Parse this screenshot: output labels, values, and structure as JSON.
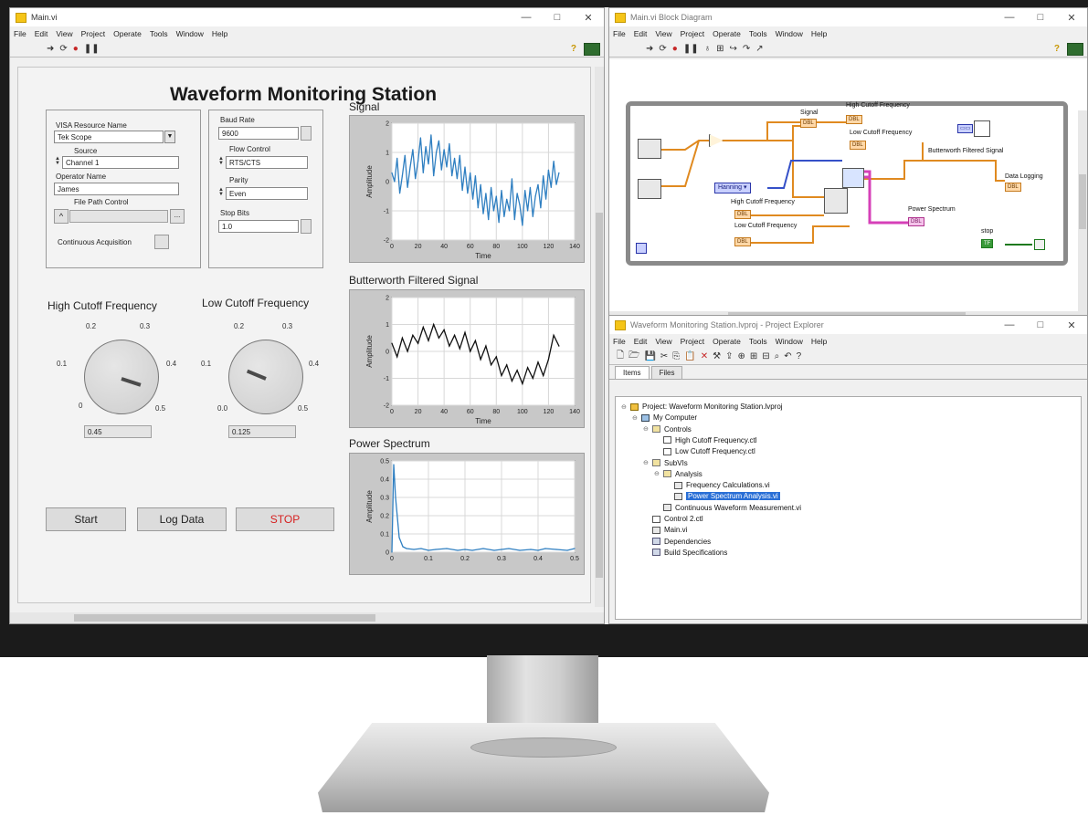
{
  "front_panel": {
    "window_title": "Main.vi",
    "menu": [
      "File",
      "Edit",
      "View",
      "Project",
      "Operate",
      "Tools",
      "Window",
      "Help"
    ],
    "controls": {
      "minimize": "—",
      "maximize": "□",
      "close": "✕"
    },
    "heading": "Waveform Monitoring Station",
    "visa_resource_label": "VISA Resource Name",
    "visa_resource_value": "Tek Scope",
    "source_label": "Source",
    "source_value": "Channel 1",
    "operator_label": "Operator Name",
    "operator_value": "James",
    "file_path_label": "File Path Control",
    "continuous_label": "Continuous Acquisition",
    "baud_label": "Baud Rate",
    "baud_value": "9600",
    "flow_label": "Flow Control",
    "flow_value": "RTS/CTS",
    "parity_label": "Parity",
    "parity_value": "Even",
    "stop_bits_label": "Stop Bits",
    "stop_bits_value": "1.0",
    "high_knob_title": "High Cutoff Frequency",
    "low_knob_title": "Low Cutoff Frequency",
    "high_knob_value": 0.45,
    "low_knob_value": 0.125,
    "high_knob_display": "0.45",
    "low_knob_display": "0.125",
    "high_ticks": [
      "0.1",
      "0.2",
      "0.3",
      "0.4",
      "0",
      "0.5"
    ],
    "low_ticks": [
      "0.1",
      "0.2",
      "0.3",
      "0.4",
      "0.0",
      "0.5"
    ],
    "start_label": "Start",
    "log_label": "Log Data",
    "stop_label": "STOP"
  },
  "chart_data": [
    {
      "type": "line",
      "title": "Signal",
      "xlabel": "Time",
      "ylabel": "Amplitude",
      "xlim": [
        0,
        140
      ],
      "ylim": [
        -2,
        2
      ],
      "xticks": [
        0,
        20,
        40,
        60,
        80,
        100,
        120,
        140
      ],
      "yticks": [
        -2,
        -1,
        0,
        1,
        2
      ],
      "series": [
        {
          "color": "#2f7fc1",
          "x": [
            0,
            2,
            4,
            6,
            8,
            10,
            12,
            14,
            16,
            18,
            20,
            22,
            24,
            26,
            28,
            30,
            32,
            34,
            36,
            38,
            40,
            42,
            44,
            46,
            48,
            50,
            52,
            54,
            56,
            58,
            60,
            62,
            64,
            66,
            68,
            70,
            72,
            74,
            76,
            78,
            80,
            82,
            84,
            86,
            88,
            90,
            92,
            94,
            96,
            98,
            100,
            102,
            104,
            106,
            108,
            110,
            112,
            114,
            116,
            118,
            120,
            122,
            124,
            126,
            128
          ],
          "values": [
            0.3,
            0.0,
            0.8,
            -0.4,
            0.2,
            0.9,
            -0.2,
            0.5,
            1.1,
            0.1,
            0.7,
            1.5,
            0.3,
            1.2,
            0.6,
            1.6,
            0.2,
            1.0,
            1.4,
            0.4,
            1.1,
            0.5,
            1.3,
            0.2,
            0.8,
            0.1,
            0.9,
            -0.3,
            0.5,
            -0.4,
            0.3,
            -0.6,
            0.2,
            -0.9,
            -0.1,
            -1.1,
            -0.4,
            -1.3,
            -0.2,
            -1.0,
            -0.5,
            -1.4,
            -0.3,
            -1.2,
            -0.6,
            -1.0,
            0.1,
            -1.3,
            -0.4,
            -0.8,
            -1.5,
            -0.3,
            -1.0,
            -0.2,
            -1.2,
            -0.5,
            -0.1,
            -0.9,
            0.2,
            -0.6,
            0.4,
            -0.2,
            0.7,
            -0.1,
            0.3
          ]
        }
      ]
    },
    {
      "type": "line",
      "title": "Butterworth Filtered Signal",
      "xlabel": "Time",
      "ylabel": "Amplitude",
      "xlim": [
        0,
        140
      ],
      "ylim": [
        -2,
        2
      ],
      "xticks": [
        0,
        20,
        40,
        60,
        80,
        100,
        120,
        140
      ],
      "yticks": [
        -2,
        -1,
        0,
        1,
        2
      ],
      "series": [
        {
          "color": "#111111",
          "x": [
            0,
            4,
            8,
            12,
            16,
            20,
            24,
            28,
            32,
            36,
            40,
            44,
            48,
            52,
            56,
            60,
            64,
            68,
            72,
            76,
            80,
            84,
            88,
            92,
            96,
            100,
            104,
            108,
            112,
            116,
            120,
            124,
            128
          ],
          "values": [
            0.3,
            -0.2,
            0.5,
            0.0,
            0.6,
            0.3,
            0.9,
            0.4,
            1.0,
            0.5,
            0.8,
            0.2,
            0.6,
            0.1,
            0.7,
            0.0,
            0.4,
            -0.3,
            0.2,
            -0.5,
            -0.2,
            -0.9,
            -0.5,
            -1.1,
            -0.7,
            -1.2,
            -0.6,
            -1.0,
            -0.4,
            -0.9,
            -0.3,
            0.6,
            0.2
          ]
        }
      ]
    },
    {
      "type": "line",
      "title": "Power Spectrum",
      "xlabel": "",
      "ylabel": "Amplitude",
      "xlim": [
        0,
        0.5
      ],
      "ylim": [
        0,
        0.5
      ],
      "xticks": [
        0,
        0.1,
        0.2,
        0.3,
        0.4,
        0.5
      ],
      "yticks": [
        0,
        0.1,
        0.2,
        0.3,
        0.4,
        0.5
      ],
      "series": [
        {
          "color": "#2f7fc1",
          "x": [
            0,
            0.005,
            0.01,
            0.02,
            0.03,
            0.04,
            0.06,
            0.08,
            0.1,
            0.12,
            0.15,
            0.18,
            0.2,
            0.22,
            0.25,
            0.28,
            0.3,
            0.32,
            0.35,
            0.38,
            0.4,
            0.42,
            0.45,
            0.48,
            0.5
          ],
          "values": [
            0.0,
            0.48,
            0.3,
            0.08,
            0.03,
            0.02,
            0.015,
            0.02,
            0.01,
            0.015,
            0.02,
            0.01,
            0.015,
            0.01,
            0.02,
            0.01,
            0.015,
            0.02,
            0.01,
            0.015,
            0.01,
            0.02,
            0.015,
            0.01,
            0.02
          ]
        }
      ]
    }
  ],
  "block_diagram": {
    "window_title": "Main.vi Block Diagram",
    "menu": [
      "File",
      "Edit",
      "View",
      "Project",
      "Operate",
      "Tools",
      "Window",
      "Help"
    ],
    "labels": {
      "signal": "Signal",
      "high_cutoff_top": "High Cutoff Frequency",
      "low_cutoff_top": "Low Cutoff Frequency",
      "butterworth": "Butterworth Filtered Signal",
      "data_logging": "Data Logging",
      "hanning": "Hanning",
      "high_cutoff": "High Cutoff Frequency",
      "low_cutoff": "Low Cutoff Frequency",
      "power_spectrum": "Power Spectrum",
      "stop": "stop",
      "tf": "TF"
    }
  },
  "project_explorer": {
    "window_title": "Waveform Monitoring Station.lvproj - Project Explorer",
    "menu": [
      "File",
      "Edit",
      "View",
      "Project",
      "Operate",
      "Tools",
      "Window",
      "Help"
    ],
    "tabs": [
      "Items",
      "Files"
    ],
    "tree": [
      {
        "label": "Project: Waveform Monitoring Station.lvproj",
        "icon": "proj",
        "depth": 0
      },
      {
        "label": "My Computer",
        "icon": "pc",
        "depth": 1
      },
      {
        "label": "Controls",
        "icon": "folder",
        "depth": 2
      },
      {
        "label": "High Cutoff Frequency.ctl",
        "icon": "ctl",
        "depth": 3
      },
      {
        "label": "Low Cutoff Frequency.ctl",
        "icon": "ctl",
        "depth": 3
      },
      {
        "label": "SubVIs",
        "icon": "folder",
        "depth": 2
      },
      {
        "label": "Analysis",
        "icon": "folder",
        "depth": 3
      },
      {
        "label": "Frequency Calculations.vi",
        "icon": "vi",
        "depth": 4
      },
      {
        "label": "Power Spectrum Analysis.vi",
        "icon": "vi",
        "depth": 4,
        "selected": true
      },
      {
        "label": "Continuous Waveform Measurement.vi",
        "icon": "vi",
        "depth": 3
      },
      {
        "label": "Control 2.ctl",
        "icon": "ctl",
        "depth": 2
      },
      {
        "label": "Main.vi",
        "icon": "vi",
        "depth": 2
      },
      {
        "label": "Dependencies",
        "icon": "dep",
        "depth": 2
      },
      {
        "label": "Build Specifications",
        "icon": "dep",
        "depth": 2
      }
    ]
  },
  "toolbar_icons": [
    "run-arrow-icon",
    "run-continuous-icon",
    "abort-icon",
    "pause-icon",
    "highlight-bulb-icon",
    "retain-wire-icon",
    "step-into-icon",
    "step-over-icon",
    "step-out-icon",
    "help-icon"
  ],
  "colors": {
    "signal_trace": "#2f7fc1",
    "filtered_trace": "#111111",
    "stop_text": "#d62020",
    "wire_orange": "#e08a20",
    "wire_blue": "#3550c8",
    "wire_pink": "#d640b8",
    "selected_item": "#2a6fd6"
  }
}
